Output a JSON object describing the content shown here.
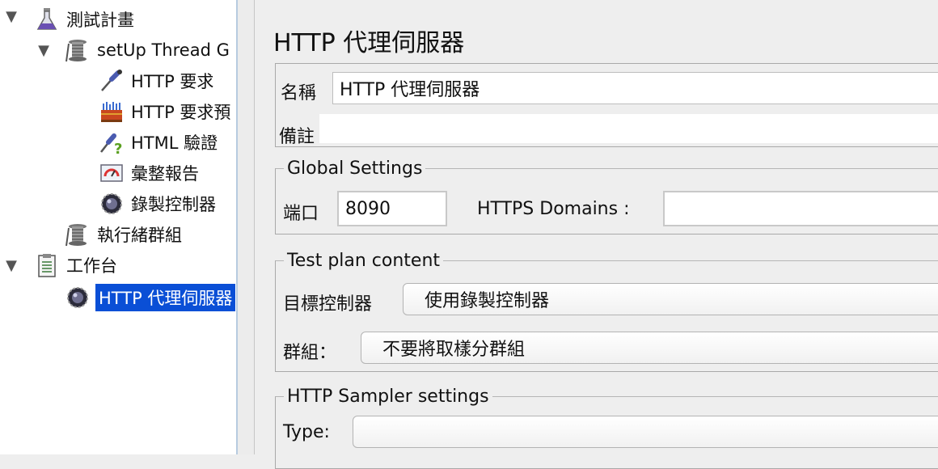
{
  "tree": {
    "items": [
      {
        "label": "測試計畫",
        "icon": "flask-icon"
      },
      {
        "label": "setUp Thread G",
        "icon": "spool-icon"
      },
      {
        "label": "HTTP 要求",
        "icon": "pipette-icon"
      },
      {
        "label": "HTTP 要求預",
        "icon": "toolbox-icon"
      },
      {
        "label": "HTML 驗證",
        "icon": "pipette-question-icon"
      },
      {
        "label": "彙整報告",
        "icon": "report-icon"
      },
      {
        "label": "錄製控制器",
        "icon": "recorder-icon"
      },
      {
        "label": "執行緒群組",
        "icon": "spool-icon"
      },
      {
        "label": "工作台",
        "icon": "clipboard-icon"
      },
      {
        "label": "HTTP 代理伺服器",
        "icon": "recorder-icon"
      }
    ],
    "selected_index": 9,
    "selection_color": "#0a4fd6"
  },
  "panel": {
    "title": "HTTP 代理伺服器",
    "name_label": "名稱",
    "name_value": "HTTP 代理伺服器",
    "comment_label": "備註",
    "comment_value": ""
  },
  "global_settings": {
    "legend": "Global Settings",
    "port_label": "端口",
    "port_value": "8090",
    "https_label": "HTTPS Domains :",
    "https_value": ""
  },
  "test_plan": {
    "legend": "Test plan content",
    "target_label": "目標控制器",
    "target_value": "使用錄製控制器",
    "group_label": "群組：",
    "group_value": "不要將取樣分群組"
  },
  "sampler": {
    "legend": "HTTP Sampler settings",
    "type_label": "Type:",
    "type_value": ""
  }
}
